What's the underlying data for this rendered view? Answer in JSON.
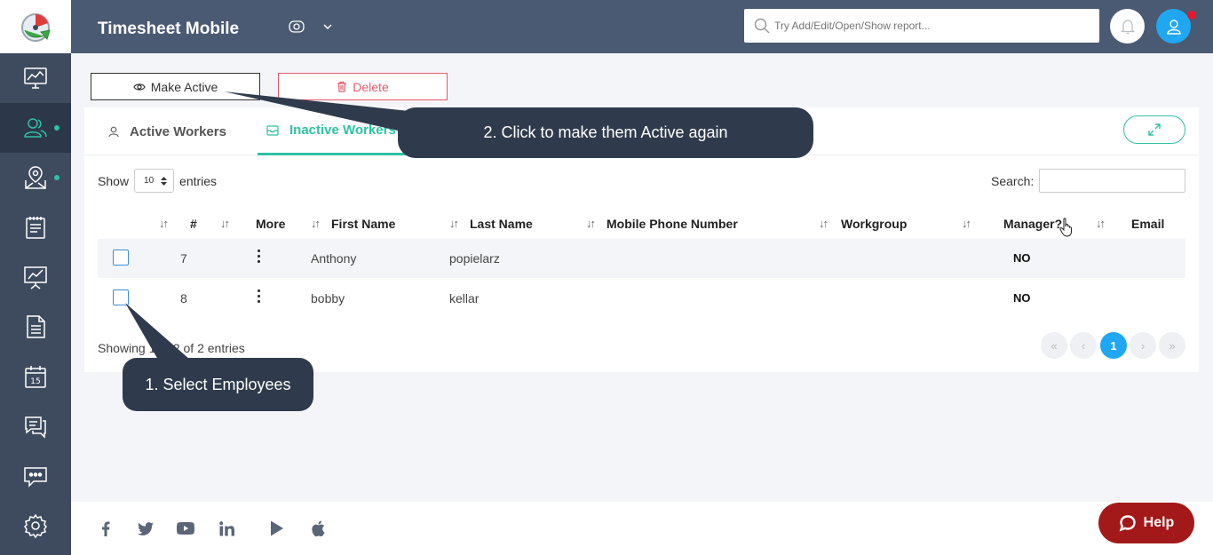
{
  "header": {
    "title": "Timesheet Mobile",
    "search_placeholder": "Try Add/Edit/Open/Show report..."
  },
  "actions": {
    "make_active": "Make Active",
    "delete": "Delete"
  },
  "tabs": [
    {
      "label": "Active Workers"
    },
    {
      "label": "Inactive Workers"
    }
  ],
  "table_controls": {
    "show_label": "Show",
    "entries_value": "10",
    "entries_label": "entries",
    "search_label": "Search:"
  },
  "columns": {
    "num": "#",
    "more": "More",
    "first_name": "First Name",
    "last_name": "Last Name",
    "mobile": "Mobile Phone Number",
    "workgroup": "Workgroup",
    "manager": "Manager?",
    "email": "Email"
  },
  "rows": [
    {
      "num": "7",
      "first_name": "Anthony",
      "last_name": "popielarz",
      "manager": "NO"
    },
    {
      "num": "8",
      "first_name": "bobby",
      "last_name": "kellar",
      "manager": "NO"
    }
  ],
  "pagination": {
    "info": "Showing 1 to 2 of 2 entries",
    "current_page": "1"
  },
  "callouts": {
    "step1": "1. Select Employees",
    "step2": "2. Click to make them Active again"
  },
  "footer": {
    "help_label": "Help"
  },
  "colors": {
    "sidebar": "#3e4b5e",
    "header": "#4a5a72",
    "accent_teal": "#2fc1a4",
    "accent_blue": "#1fa7f2",
    "danger": "#e25b6b",
    "help": "#a31919"
  }
}
